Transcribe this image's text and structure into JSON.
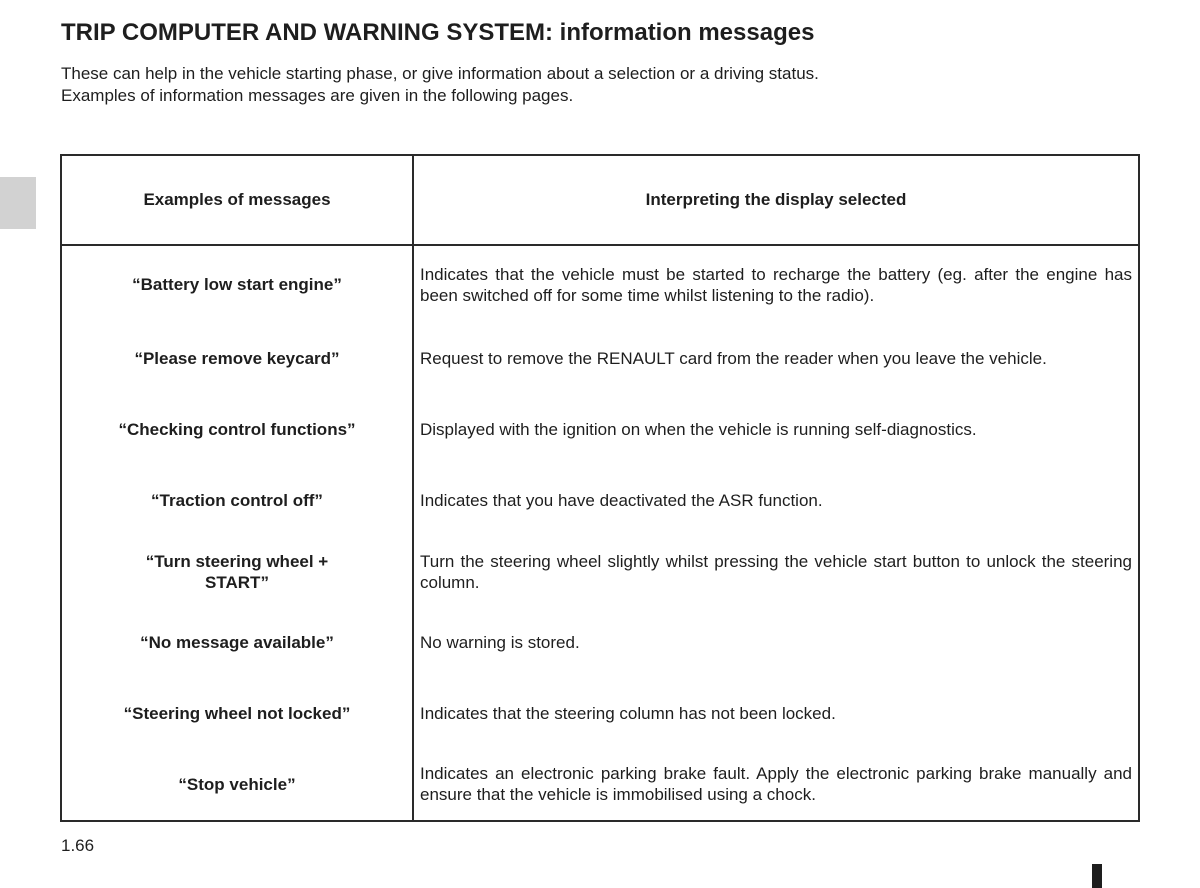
{
  "page": {
    "title": "TRIP COMPUTER AND WARNING SYSTEM: information messages",
    "intro": [
      "These can help in the vehicle starting phase, or give information about a selection or a driving status.",
      "Examples of information messages are given in the following pages."
    ],
    "page_number": "1.66"
  },
  "table": {
    "headers": [
      "Examples of messages",
      "Interpreting the display selected"
    ],
    "rows": [
      {
        "message": "“Battery low start engine”",
        "interpretation": "Indicates that the vehicle must be started to recharge the battery (eg. after the engine has been switched off for some time whilst listening to the radio)."
      },
      {
        "message": "“Please remove keycard”",
        "interpretation": "Request to remove the RENAULT card from the reader when you leave the vehicle."
      },
      {
        "message": "“Checking control functions”",
        "interpretation": "Displayed with the ignition on when the vehicle is running self-diagnostics."
      },
      {
        "message": "“Traction control off”",
        "interpretation": "Indicates that you have deactivated the ASR function."
      },
      {
        "message": "“Turn steering wheel + START”",
        "interpretation": "Turn the steering wheel slightly whilst pressing the vehicle start button to unlock the steering column."
      },
      {
        "message": "“No message available”",
        "interpretation": "No warning is stored."
      },
      {
        "message": "“Steering wheel not locked”",
        "interpretation": "Indicates that the steering column has not been locked."
      },
      {
        "message": "“Stop vehicle”",
        "interpretation": "Indicates an electronic parking brake fault. Apply the electronic parking brake manually and ensure that the vehicle is immobilised using a chock."
      }
    ]
  }
}
